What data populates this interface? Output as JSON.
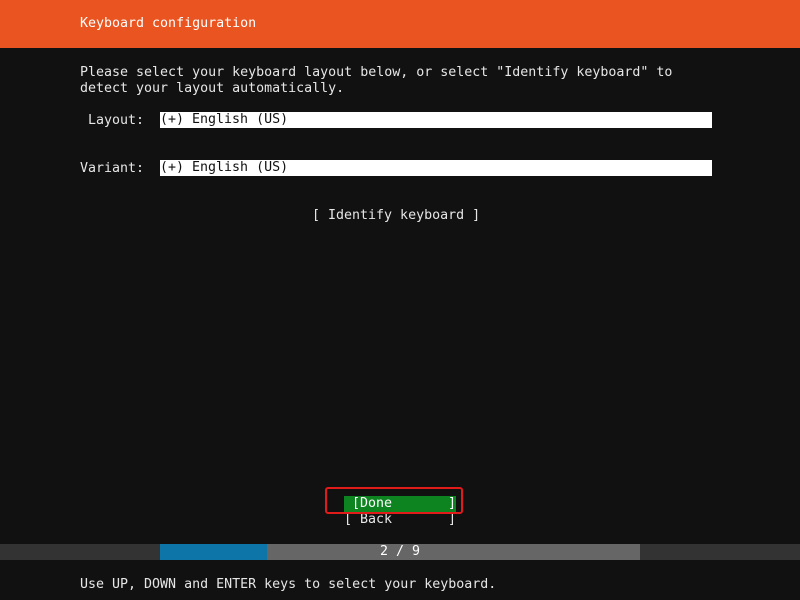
{
  "header": {
    "title": "Keyboard configuration"
  },
  "instructions": "Please select your keyboard layout below, or select \"Identify keyboard\" to\ndetect your layout automatically.",
  "fields": {
    "layout": {
      "label": "Layout:",
      "value": "(+) English (US)"
    },
    "variant": {
      "label": "Variant:",
      "value": "(+) English (US)"
    }
  },
  "buttons": {
    "identify": "[ Identify keyboard ]",
    "done": {
      "open": "[",
      "label": "Done",
      "close": "]"
    },
    "back": {
      "open": "[",
      "label": "Back",
      "close": "]"
    }
  },
  "progress": {
    "text": "2 / 9",
    "current": 2,
    "total": 9
  },
  "footer": {
    "hint": "Use UP, DOWN and ENTER keys to select your keyboard."
  },
  "colors": {
    "header": "#e95420",
    "background": "#111111",
    "selected_button": "#0e8420",
    "progress_fill": "#0e75a9",
    "progress_track": "#666666",
    "highlight": "#e11a1a"
  }
}
